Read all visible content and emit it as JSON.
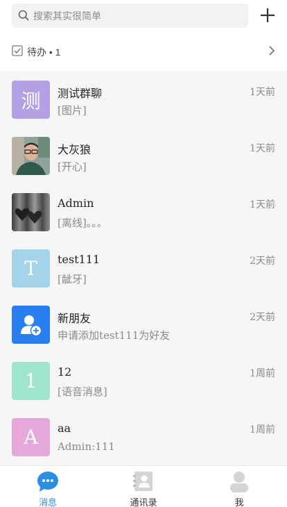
{
  "search": {
    "placeholder": "搜索其实很简单"
  },
  "todo": {
    "label": "待办 • 1"
  },
  "conversations": [
    {
      "name": "测试群聊",
      "preview": "[图片]",
      "time": "1天前",
      "avatar_text": "测",
      "avatar_color": "#b3a1e3"
    },
    {
      "name": "大灰狼",
      "preview": "[开心]",
      "time": "1天前",
      "avatar_text": "",
      "avatar_color": "#3f6b66"
    },
    {
      "name": "Admin",
      "preview": "[离线]。。。",
      "time": "1天前",
      "avatar_text": "",
      "avatar_color": "#5b5b5b"
    },
    {
      "name": "test111",
      "preview": "[龇牙]",
      "time": "2天前",
      "avatar_text": "T",
      "avatar_color": "#a4d3ea"
    },
    {
      "name": "新朋友",
      "preview": "申请添加test111为好友",
      "time": "2天前",
      "avatar_text": "",
      "avatar_color": "#2a7ff0"
    },
    {
      "name": "12",
      "preview": "[语音消息]",
      "time": "1周前",
      "avatar_text": "1",
      "avatar_color": "#9ee4cf"
    },
    {
      "name": "aa",
      "preview": "Admin:111",
      "time": "1周前",
      "avatar_text": "A",
      "avatar_color": "#e6a8db"
    }
  ],
  "tabs": [
    {
      "label": "消息",
      "active": true,
      "icon": "chat-bubble-icon"
    },
    {
      "label": "通讯录",
      "active": false,
      "icon": "contacts-book-icon"
    },
    {
      "label": "我",
      "active": false,
      "icon": "person-icon"
    }
  ],
  "colors": {
    "accent": "#2b8ee0",
    "list_background": "#f5f7f7"
  }
}
